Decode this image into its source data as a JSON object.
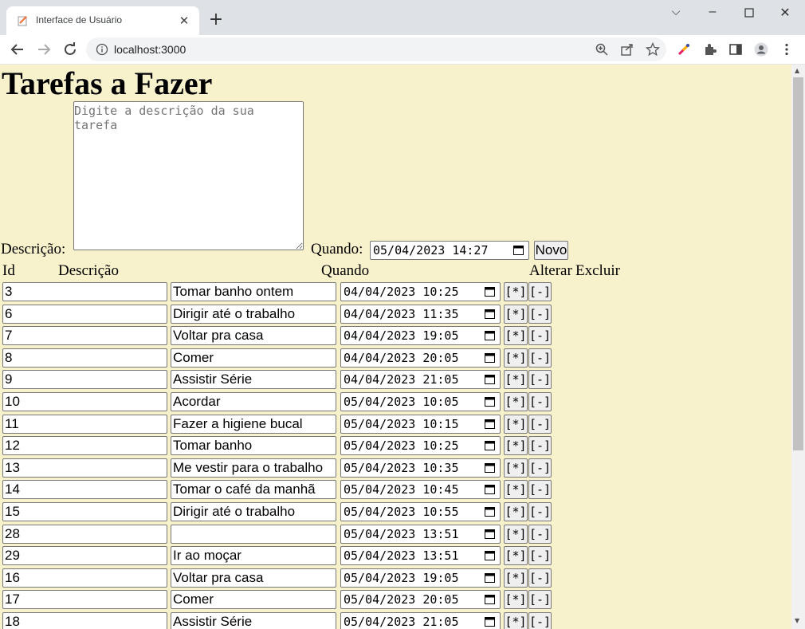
{
  "browser": {
    "tab_title": "Interface de Usuário",
    "url": "localhost:3000"
  },
  "page": {
    "title": "Tarefas a Fazer",
    "form": {
      "descricao_label": "Descrição:",
      "descricao_placeholder": "Digite a descrição da sua tarefa",
      "quando_label": "Quando:",
      "quando_value": "05/04/2023 14:27",
      "novo_label": "Novo"
    },
    "table": {
      "headers": {
        "id": "Id",
        "descricao": "Descrição",
        "quando": "Quando",
        "alterar": "Alterar",
        "excluir": "Excluir"
      },
      "alterar_button": "[*]",
      "excluir_button": "[-]",
      "rows": [
        {
          "id": "3",
          "descricao": "Tomar banho ontem",
          "quando": "04/04/2023 10:25"
        },
        {
          "id": "6",
          "descricao": "Dirigir até o trabalho",
          "quando": "04/04/2023 11:35"
        },
        {
          "id": "7",
          "descricao": "Voltar pra casa",
          "quando": "04/04/2023 19:05"
        },
        {
          "id": "8",
          "descricao": "Comer",
          "quando": "04/04/2023 20:05"
        },
        {
          "id": "9",
          "descricao": "Assistir Série",
          "quando": "04/04/2023 21:05"
        },
        {
          "id": "10",
          "descricao": "Acordar",
          "quando": "05/04/2023 10:05"
        },
        {
          "id": "11",
          "descricao": "Fazer a higiene bucal",
          "quando": "05/04/2023 10:15"
        },
        {
          "id": "12",
          "descricao": "Tomar banho",
          "quando": "05/04/2023 10:25"
        },
        {
          "id": "13",
          "descricao": "Me vestir para o trabalho",
          "quando": "05/04/2023 10:35"
        },
        {
          "id": "14",
          "descricao": "Tomar o café da manhã",
          "quando": "05/04/2023 10:45"
        },
        {
          "id": "15",
          "descricao": "Dirigir até o trabalho",
          "quando": "05/04/2023 10:55"
        },
        {
          "id": "28",
          "descricao": "",
          "quando": "05/04/2023 13:51"
        },
        {
          "id": "29",
          "descricao": "Ir ao moçar",
          "quando": "05/04/2023 13:51"
        },
        {
          "id": "16",
          "descricao": "Voltar pra casa",
          "quando": "05/04/2023 19:05"
        },
        {
          "id": "17",
          "descricao": "Comer",
          "quando": "05/04/2023 20:05"
        },
        {
          "id": "18",
          "descricao": "Assistir Série",
          "quando": "05/04/2023 21:05"
        }
      ]
    }
  }
}
